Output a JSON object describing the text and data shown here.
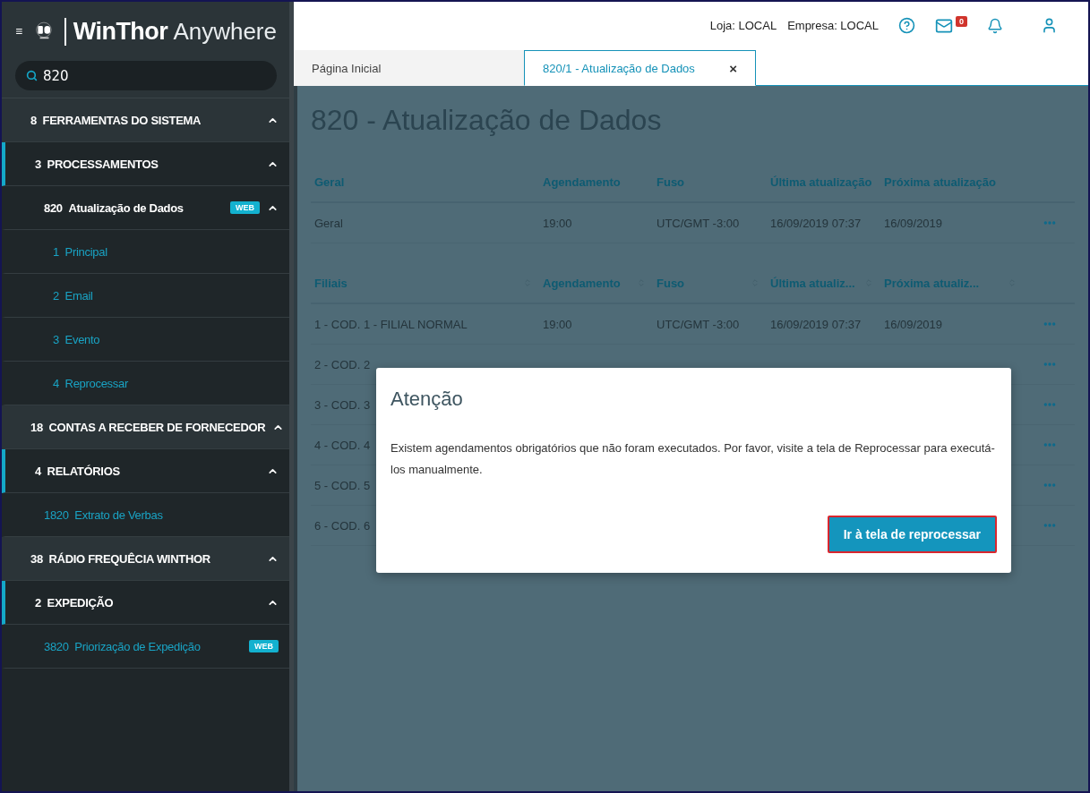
{
  "brand": {
    "name": "WinThor",
    "suffix": "Anywhere"
  },
  "search": {
    "value": "820"
  },
  "sidebar": {
    "items": [
      {
        "code": "8",
        "label": "FERRAMENTAS DO SISTEMA",
        "expanded": true,
        "children": [
          {
            "code": "3",
            "label": "PROCESSAMENTOS",
            "expanded": true,
            "children": [
              {
                "code": "820",
                "label": "Atualização de Dados",
                "badge": "WEB",
                "expanded": true,
                "children": [
                  {
                    "code": "1",
                    "label": "Principal"
                  },
                  {
                    "code": "2",
                    "label": "Email"
                  },
                  {
                    "code": "3",
                    "label": "Evento"
                  },
                  {
                    "code": "4",
                    "label": "Reprocessar"
                  }
                ]
              }
            ]
          }
        ]
      },
      {
        "code": "18",
        "label": "CONTAS A RECEBER DE FORNECEDOR",
        "expanded": true,
        "children": [
          {
            "code": "4",
            "label": "RELATÓRIOS",
            "expanded": true,
            "children": [
              {
                "code": "1820",
                "label": "Extrato de Verbas"
              }
            ]
          }
        ]
      },
      {
        "code": "38",
        "label": "RÁDIO FREQUÊCIA WINTHOR",
        "expanded": true,
        "children": [
          {
            "code": "2",
            "label": "EXPEDIÇÃO",
            "expanded": true,
            "children": [
              {
                "code": "3820",
                "label": "Priorização de Expedição",
                "badge": "WEB"
              }
            ]
          }
        ]
      }
    ]
  },
  "header": {
    "store": "Loja: LOCAL",
    "company": "Empresa: LOCAL",
    "mail_count": "0"
  },
  "tabs": [
    {
      "label": "Página Inicial",
      "selected": false
    },
    {
      "label": "820/1 - Atualização de Dados",
      "selected": true,
      "close": "×"
    }
  ],
  "page_title": "820 - Atualização de Dados",
  "general_table": {
    "columns": [
      "Geral",
      "Agendamento",
      "Fuso",
      "Última atualização",
      "Próxima atualização"
    ],
    "rows": [
      {
        "cells": [
          "Geral",
          "19:00",
          "UTC/GMT -3:00",
          "16/09/2019 07:37",
          "16/09/2019"
        ]
      }
    ]
  },
  "branches_table": {
    "columns": [
      "Filiais",
      "Agendamento",
      "Fuso",
      "Última atualiz...",
      "Próxima atualiz..."
    ],
    "rows": [
      {
        "cells": [
          "1 - COD. 1 - FILIAL NORMAL",
          "19:00",
          "UTC/GMT -3:00",
          "16/09/2019 07:37",
          "16/09/2019"
        ]
      },
      {
        "cells": [
          "2 - COD. 2"
        ]
      },
      {
        "cells": [
          "3 - COD. 3"
        ]
      },
      {
        "cells": [
          "4 - COD. 4"
        ]
      },
      {
        "cells": [
          "5 - COD. 5"
        ]
      },
      {
        "cells": [
          "6 - COD. 6"
        ]
      }
    ]
  },
  "dialog": {
    "title": "Atenção",
    "message": "Existem agendamentos obrigatórios que não foram executados. Por favor, visite a tela de Reprocessar para executá-los manualmente.",
    "button": "Ir à tela de reprocessar"
  }
}
